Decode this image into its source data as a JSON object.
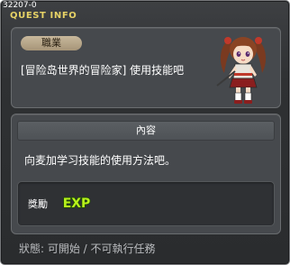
{
  "quest_id": "32207-0",
  "window": {
    "title": "QUEST INFO"
  },
  "quest": {
    "job_label": "職業",
    "title": "[冒险岛世界的冒险家] 使用技能吧",
    "section_header": "內容",
    "description": "向麦加学习技能的使用方法吧。",
    "reward_label": "獎勵",
    "reward_icon": "exp-icon",
    "reward_text": "EXP",
    "status": "狀態: 可開始 / 不可執行任務"
  },
  "colors": {
    "title": "#e6d266",
    "badge": "#b8a78a",
    "exp_fill": "#b8f21c",
    "exp_outline": "#1f4a06"
  }
}
